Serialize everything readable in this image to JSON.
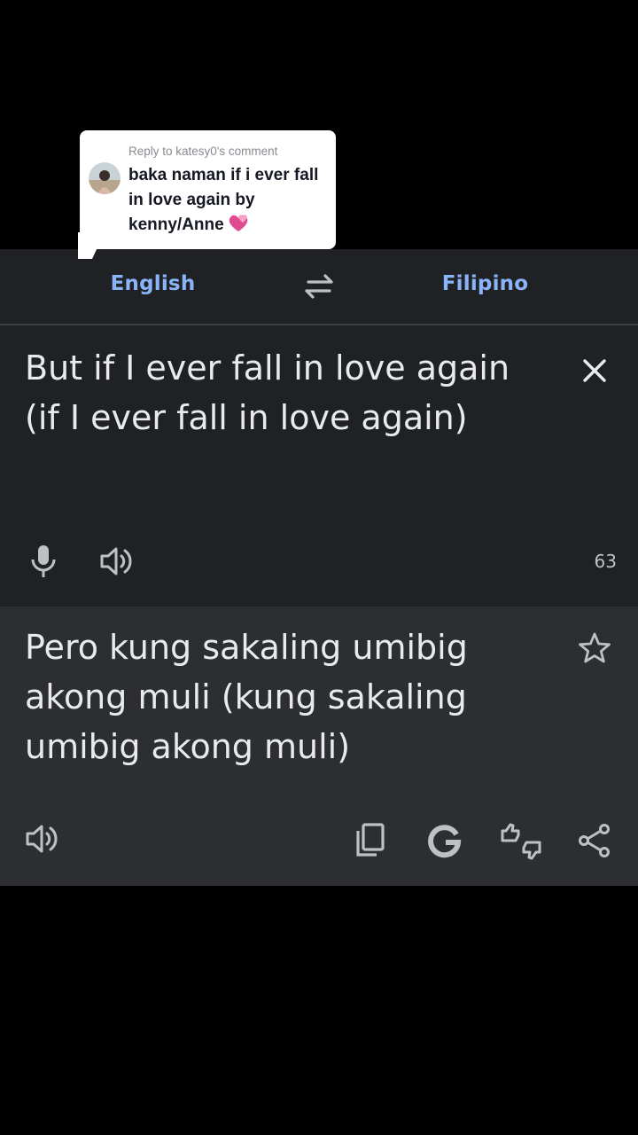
{
  "reply": {
    "header": "Reply to katesy0's comment",
    "comment": "baka naman if i ever fall in love again by kenny/Anne",
    "emoji": "revolving-hearts"
  },
  "translator": {
    "source_language": "English",
    "target_language": "Filipino",
    "source_text": "But if I ever fall in love again (if I ever fall in love again)",
    "char_count": "63",
    "translated_text": "Pero kung sakaling umibig akong muli (kung sakaling umibig akong muli)",
    "icons": {
      "swap": "swap-languages-icon",
      "close": "close-icon",
      "mic": "microphone-icon",
      "speaker": "speaker-icon",
      "star": "star-icon",
      "copy": "copy-icon",
      "google": "google-icon",
      "feedback": "feedback-thumbs-icon",
      "share": "share-icon"
    },
    "colors": {
      "accent": "#8ab4f8",
      "panel": "#202124",
      "result_panel": "#2d2e31",
      "text": "#e8eaed"
    }
  }
}
